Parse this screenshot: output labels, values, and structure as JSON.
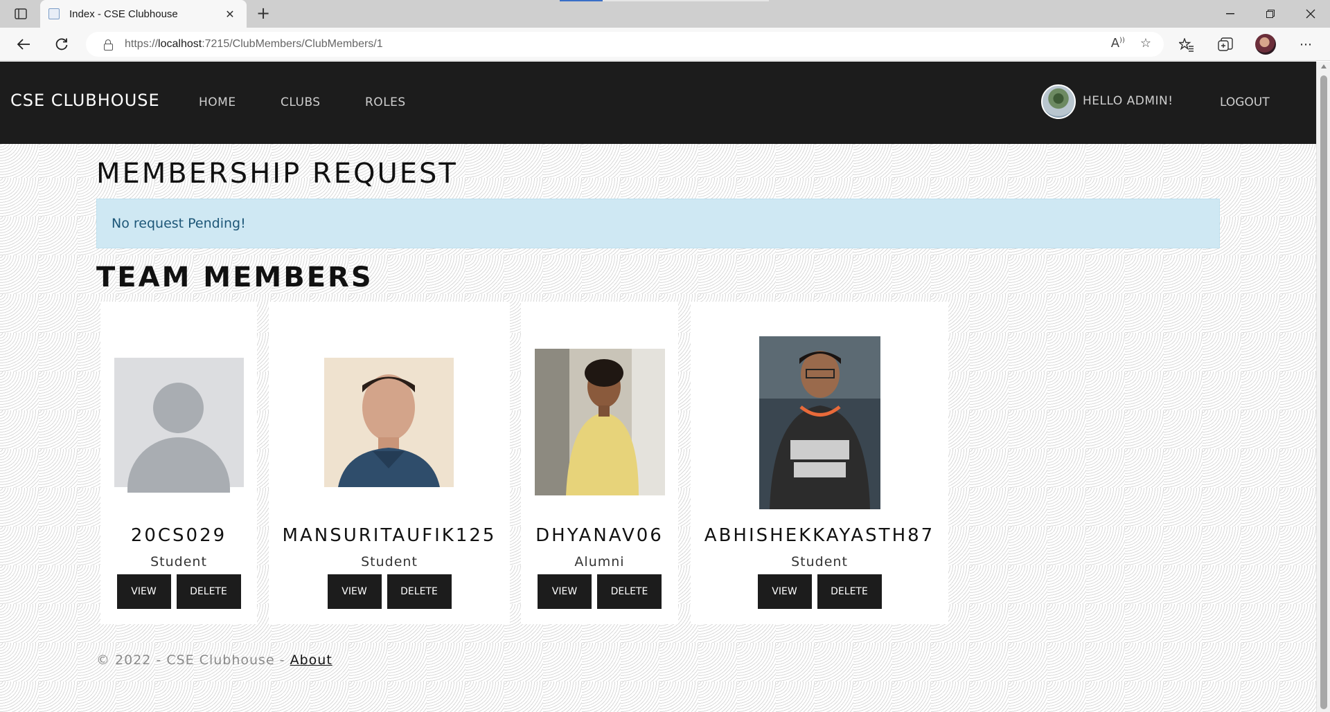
{
  "browser": {
    "tab_title": "Index - CSE Clubhouse",
    "url_prefix": "https://",
    "url_host": "localhost",
    "url_path": ":7215/ClubMembers/ClubMembers/1"
  },
  "navbar": {
    "brand": "CSE CLUBHOUSE",
    "links": [
      "HOME",
      "CLUBS",
      "ROLES"
    ],
    "greeting": "HELLO ADMIN!",
    "logout": "LOGOUT"
  },
  "membership": {
    "heading": "MEMBERSHIP REQUEST",
    "alert": "No request Pending!"
  },
  "team": {
    "heading": "TEAM MEMBERS",
    "members": [
      {
        "name": "20CS029",
        "role": "Student",
        "photo": "default-avatar"
      },
      {
        "name": "MANSURITAUFIK125",
        "role": "Student",
        "photo": "photo"
      },
      {
        "name": "DHYANAV06",
        "role": "Alumni",
        "photo": "photo"
      },
      {
        "name": "ABHISHEKKAYASTH87",
        "role": "Student",
        "photo": "photo"
      }
    ],
    "view_label": "VIEW",
    "delete_label": "DELETE"
  },
  "footer": {
    "text": "© 2022 - CSE Clubhouse - ",
    "link": "About"
  },
  "colors": {
    "navbar": "#1c1c1c",
    "alert_bg": "#cfe8f3",
    "alert_text": "#1d5677",
    "button": "#1c1c1c"
  }
}
